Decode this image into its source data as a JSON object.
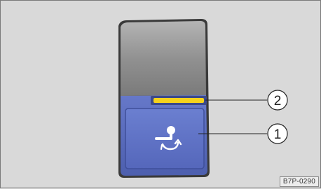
{
  "callouts": [
    {
      "number": "2",
      "target": "indicator-light"
    },
    {
      "number": "1",
      "target": "button"
    }
  ],
  "image_code": "B7P-0290",
  "colors": {
    "button_blue": "#5a6fc4",
    "upper_gray": "#8e8e8e",
    "indicator_yellow": "#f5d21c",
    "background": "#d9d9d9"
  },
  "button": {
    "icon": "tow-hitch-swivel-icon"
  }
}
